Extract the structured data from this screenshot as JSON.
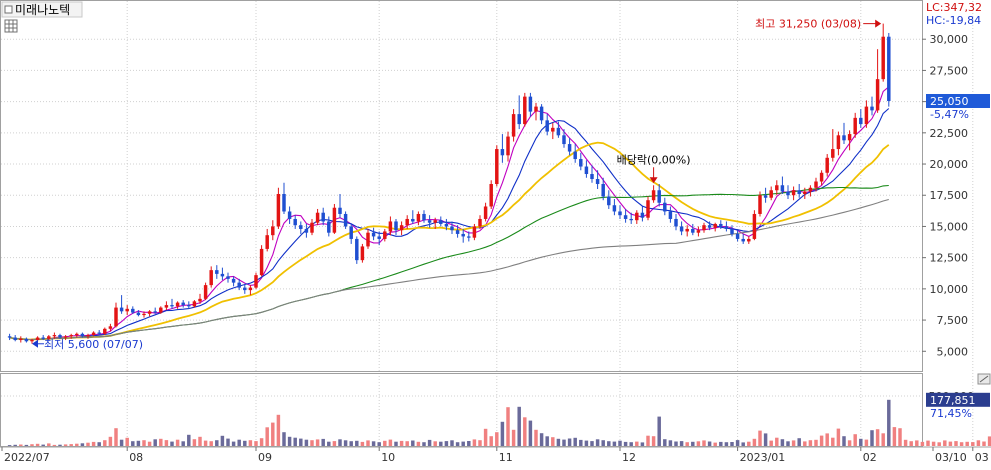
{
  "header": {
    "stock_name": "미래나노텍",
    "icon": "grid-table-icon"
  },
  "top_readout": {
    "lc": "LC:347,32",
    "hc": "HC:-19,84"
  },
  "annotations": {
    "high": "최고 31,250 (03/08)",
    "low": "최저 5,600 (07/07)",
    "dividend": "배당락(0,00%)"
  },
  "price_panel": {
    "current_price": "25,050",
    "change_pct": "-5,47%"
  },
  "volume_panel": {
    "current_volume": "177,851",
    "volume_pct": "71,45%"
  },
  "colors": {
    "up": "#e31414",
    "down": "#1f4fd1",
    "ma5": "#c000c0",
    "ma10": "#1030c8",
    "ma20": "#f0c000",
    "ma60": "#1a8a1a",
    "ma120": "#808080",
    "vol_up": "#f08080",
    "vol_down": "#6a6a9a",
    "grid": "#d0d0d0"
  },
  "chart_data": {
    "type": "candlestick",
    "x_axis_labels": [
      "2022/07",
      "08",
      "09",
      "10",
      "11",
      "12",
      "2023/01",
      "02",
      "03",
      "03/10"
    ],
    "y_ticks": [
      "30,000",
      "27,500",
      "25,000",
      "22,500",
      "20,000",
      "17,500",
      "15,000",
      "12,500",
      "10,000",
      "7,500",
      "5,000"
    ],
    "y_tick_values": [
      30000,
      27500,
      25000,
      22500,
      20000,
      17500,
      15000,
      12500,
      10000,
      7500,
      5000
    ],
    "ylim": [
      3500,
      32500
    ],
    "volume_ticks": [
      "500,000"
    ],
    "volume_tick_values": [
      500000
    ],
    "volume_ylim": [
      0,
      700000
    ],
    "month_start_index": [
      0,
      21,
      44,
      66,
      87,
      109,
      130,
      152,
      172,
      177
    ],
    "candles": [
      [
        6200,
        6400,
        5900,
        6100
      ],
      [
        6100,
        6300,
        5800,
        5900
      ],
      [
        5900,
        6200,
        5700,
        6000
      ],
      [
        6000,
        6100,
        5700,
        5800
      ],
      [
        5800,
        6000,
        5600,
        5900
      ],
      [
        5900,
        6200,
        5800,
        6100
      ],
      [
        6100,
        6300,
        5900,
        6000
      ],
      [
        6000,
        6300,
        5900,
        6200
      ],
      [
        6200,
        6500,
        6000,
        6300
      ],
      [
        6300,
        6400,
        6000,
        6100
      ],
      [
        6100,
        6300,
        5900,
        6200
      ],
      [
        6200,
        6400,
        6000,
        6300
      ],
      [
        6300,
        6500,
        6100,
        6400
      ],
      [
        6400,
        6500,
        6100,
        6200
      ],
      [
        6200,
        6400,
        6000,
        6300
      ],
      [
        6300,
        6600,
        6200,
        6500
      ],
      [
        6500,
        6700,
        6300,
        6400
      ],
      [
        6400,
        6900,
        6300,
        6800
      ],
      [
        6800,
        7200,
        6600,
        7000
      ],
      [
        7000,
        8900,
        6900,
        8500
      ],
      [
        8500,
        9500,
        8000,
        8200
      ],
      [
        8200,
        8700,
        7900,
        8400
      ],
      [
        8400,
        8600,
        8000,
        8100
      ],
      [
        8100,
        8300,
        7800,
        7900
      ],
      [
        7900,
        8200,
        7700,
        8000
      ],
      [
        8000,
        8300,
        7800,
        8200
      ],
      [
        8200,
        8500,
        8000,
        8100
      ],
      [
        8100,
        8600,
        8000,
        8500
      ],
      [
        8500,
        9000,
        8300,
        8700
      ],
      [
        8700,
        9200,
        8400,
        8600
      ],
      [
        8600,
        9000,
        8400,
        8900
      ],
      [
        8900,
        9100,
        8500,
        8700
      ],
      [
        8700,
        9000,
        8400,
        8600
      ],
      [
        8600,
        9100,
        8500,
        9000
      ],
      [
        9000,
        9600,
        8800,
        9200
      ],
      [
        9200,
        10500,
        9100,
        10300
      ],
      [
        10300,
        11800,
        10100,
        11500
      ],
      [
        11500,
        11900,
        10800,
        11200
      ],
      [
        11200,
        11700,
        10700,
        11000
      ],
      [
        11000,
        11300,
        10500,
        10800
      ],
      [
        10800,
        11000,
        10200,
        10500
      ],
      [
        10500,
        10800,
        9900,
        10100
      ],
      [
        10100,
        10400,
        9600,
        9900
      ],
      [
        9900,
        10300,
        9500,
        10100
      ],
      [
        10100,
        11300,
        10000,
        11100
      ],
      [
        11100,
        13500,
        11000,
        13200
      ],
      [
        13200,
        14800,
        13000,
        14300
      ],
      [
        14300,
        15500,
        13900,
        15000
      ],
      [
        15000,
        18100,
        14800,
        17600
      ],
      [
        17600,
        18500,
        16000,
        16200
      ],
      [
        16200,
        16600,
        15200,
        15600
      ],
      [
        15600,
        15900,
        14800,
        15100
      ],
      [
        15100,
        15400,
        14400,
        14800
      ],
      [
        14800,
        15200,
        14100,
        14500
      ],
      [
        14500,
        15600,
        14300,
        15300
      ],
      [
        15300,
        16400,
        15100,
        16100
      ],
      [
        16100,
        16500,
        15100,
        15400
      ],
      [
        15400,
        15800,
        14200,
        14500
      ],
      [
        14500,
        16800,
        14400,
        16500
      ],
      [
        16500,
        17600,
        15700,
        16000
      ],
      [
        16000,
        16200,
        14800,
        15000
      ],
      [
        15000,
        15200,
        13600,
        14000
      ],
      [
        14000,
        14200,
        12000,
        12300
      ],
      [
        12300,
        13600,
        12100,
        13400
      ],
      [
        13400,
        14800,
        13200,
        14500
      ],
      [
        14500,
        14900,
        13900,
        14200
      ],
      [
        14200,
        14600,
        13500,
        14000
      ],
      [
        14000,
        14800,
        13800,
        14600
      ],
      [
        14600,
        15800,
        14300,
        15400
      ],
      [
        15400,
        15600,
        14300,
        14700
      ],
      [
        14700,
        15400,
        14300,
        15100
      ],
      [
        15100,
        15900,
        14800,
        15600
      ],
      [
        15600,
        16300,
        15200,
        15400
      ],
      [
        15400,
        16200,
        15100,
        16000
      ],
      [
        16000,
        16300,
        15300,
        15500
      ],
      [
        15500,
        15900,
        14900,
        15300
      ],
      [
        15300,
        15700,
        14800,
        15500
      ],
      [
        15500,
        15800,
        15000,
        15200
      ],
      [
        15200,
        15600,
        14700,
        15000
      ],
      [
        15000,
        15400,
        14400,
        14700
      ],
      [
        14700,
        15100,
        14100,
        14400
      ],
      [
        14400,
        14800,
        13700,
        14200
      ],
      [
        14200,
        14600,
        13800,
        14100
      ],
      [
        14100,
        15200,
        13900,
        15000
      ],
      [
        15000,
        15900,
        14800,
        15600
      ],
      [
        15600,
        16900,
        15400,
        16600
      ],
      [
        16600,
        18700,
        16400,
        18400
      ],
      [
        18400,
        21500,
        18200,
        21200
      ],
      [
        21200,
        22400,
        20100,
        20700
      ],
      [
        20700,
        22600,
        20200,
        22200
      ],
      [
        22200,
        24400,
        21800,
        24000
      ],
      [
        24000,
        25500,
        22800,
        23200
      ],
      [
        23200,
        25700,
        23000,
        25400
      ],
      [
        25400,
        25700,
        23800,
        24200
      ],
      [
        24200,
        24900,
        23500,
        24600
      ],
      [
        24600,
        24800,
        23200,
        23500
      ],
      [
        23500,
        24000,
        22300,
        22600
      ],
      [
        22600,
        23300,
        22000,
        22900
      ],
      [
        22900,
        23400,
        22100,
        22300
      ],
      [
        22300,
        22800,
        21300,
        21600
      ],
      [
        21600,
        22100,
        20700,
        21000
      ],
      [
        21000,
        21600,
        20100,
        20400
      ],
      [
        20400,
        20900,
        19500,
        19800
      ],
      [
        19800,
        20300,
        18900,
        19200
      ],
      [
        19200,
        19900,
        18500,
        18800
      ],
      [
        18800,
        19500,
        18000,
        18400
      ],
      [
        18400,
        18900,
        17100,
        17400
      ],
      [
        17400,
        17900,
        16400,
        16700
      ],
      [
        16700,
        17200,
        15900,
        16200
      ],
      [
        16200,
        16700,
        15600,
        15900
      ],
      [
        15900,
        16400,
        15300,
        15600
      ],
      [
        15600,
        16100,
        15200,
        15500
      ],
      [
        15500,
        16300,
        15200,
        16100
      ],
      [
        16100,
        16600,
        15400,
        15700
      ],
      [
        15700,
        17400,
        15500,
        17100
      ],
      [
        17100,
        18300,
        16900,
        17900
      ],
      [
        17900,
        18400,
        16600,
        16900
      ],
      [
        16900,
        17300,
        15900,
        16200
      ],
      [
        16200,
        16600,
        15300,
        15600
      ],
      [
        15600,
        16000,
        14700,
        15000
      ],
      [
        15000,
        15400,
        14300,
        14600
      ],
      [
        14600,
        15100,
        14200,
        14800
      ],
      [
        14800,
        15200,
        14300,
        14500
      ],
      [
        14500,
        15000,
        14200,
        14700
      ],
      [
        14700,
        15300,
        14500,
        15100
      ],
      [
        15100,
        15400,
        14700,
        14900
      ],
      [
        14900,
        15300,
        14600,
        15200
      ],
      [
        15200,
        15500,
        14800,
        15000
      ],
      [
        15000,
        15400,
        14600,
        14800
      ],
      [
        14800,
        15100,
        14200,
        14400
      ],
      [
        14400,
        14700,
        13800,
        14000
      ],
      [
        14000,
        14400,
        13600,
        13800
      ],
      [
        13800,
        14200,
        13600,
        14000
      ],
      [
        14000,
        16300,
        13900,
        16000
      ],
      [
        16000,
        17800,
        15800,
        17500
      ],
      [
        17500,
        18100,
        16900,
        17300
      ],
      [
        17300,
        18200,
        17100,
        17900
      ],
      [
        17900,
        18700,
        17500,
        18300
      ],
      [
        18300,
        19000,
        17600,
        17800
      ],
      [
        17800,
        18300,
        17200,
        17500
      ],
      [
        17500,
        18200,
        17100,
        17900
      ],
      [
        17900,
        18400,
        17300,
        17600
      ],
      [
        17600,
        18100,
        17200,
        17800
      ],
      [
        17800,
        18300,
        17400,
        18100
      ],
      [
        18100,
        18900,
        17800,
        18600
      ],
      [
        18600,
        19500,
        18300,
        19300
      ],
      [
        19300,
        20800,
        19000,
        20500
      ],
      [
        20500,
        22800,
        20200,
        21200
      ],
      [
        21200,
        22600,
        20700,
        22300
      ],
      [
        22300,
        23300,
        21600,
        21900
      ],
      [
        21900,
        22700,
        21100,
        22400
      ],
      [
        22400,
        24100,
        22100,
        23700
      ],
      [
        23700,
        24400,
        22900,
        23200
      ],
      [
        23200,
        25100,
        22900,
        24600
      ],
      [
        24600,
        25400,
        23900,
        24300
      ],
      [
        24300,
        29200,
        24100,
        26800
      ],
      [
        26800,
        31250,
        26600,
        30200
      ],
      [
        30200,
        30500,
        24600,
        25050
      ]
    ],
    "volumes": [
      9000,
      12000,
      15000,
      11000,
      18000,
      22000,
      14000,
      26000,
      11000,
      13000,
      16000,
      19000,
      23000,
      27000,
      33000,
      41000,
      38000,
      58000,
      92000,
      178000,
      63000,
      82000,
      48000,
      52000,
      58000,
      43000,
      67000,
      72000,
      59000,
      44000,
      63000,
      47000,
      112000,
      68000,
      92000,
      54000,
      48000,
      58000,
      102000,
      74000,
      44000,
      63000,
      52000,
      58000,
      49000,
      78000,
      187000,
      234000,
      312000,
      138000,
      92000,
      83000,
      74000,
      63000,
      58000,
      66000,
      71000,
      43000,
      49000,
      67000,
      57000,
      48000,
      52000,
      41000,
      56000,
      47000,
      38000,
      52000,
      64000,
      43000,
      51000,
      48000,
      55000,
      42000,
      38000,
      61000,
      47000,
      43000,
      49000,
      57000,
      38000,
      44000,
      50000,
      66000,
      58000,
      172000,
      98000,
      138000,
      242000,
      388000,
      162000,
      392000,
      287000,
      254000,
      162000,
      128000,
      97000,
      88000,
      72000,
      64000,
      75000,
      82000,
      61000,
      54000,
      49000,
      67000,
      58000,
      48000,
      44000,
      53000,
      41000,
      38000,
      44000,
      36000,
      103000,
      98000,
      294000,
      68000,
      57000,
      45000,
      49000,
      38000,
      42000,
      47000,
      56000,
      45000,
      34000,
      41000,
      38000,
      40000,
      59000,
      36000,
      43000,
      72000,
      154000,
      126000,
      54000,
      83000,
      68000,
      47000,
      56000,
      78000,
      46000,
      58000,
      62000,
      104000,
      126000,
      83000,
      174000,
      98000,
      57000,
      118000,
      72000,
      64000,
      158000,
      168000,
      127000,
      462000,
      189000,
      177851,
      62000,
      48000,
      56000,
      41000,
      54000,
      43000,
      37000,
      56000,
      44000,
      49000,
      38000,
      42000,
      39000,
      57000,
      45000,
      96000,
      107000,
      54000
    ],
    "series": [
      {
        "name": "",
        "kind": "ma",
        "period": 5
      },
      {
        "name": "",
        "kind": "ma",
        "period": 10
      },
      {
        "name": "",
        "kind": "ma",
        "period": 20
      },
      {
        "name": "",
        "kind": "ma",
        "period": 60
      },
      {
        "name": "",
        "kind": "ma",
        "period": 120
      }
    ],
    "grid": true
  }
}
